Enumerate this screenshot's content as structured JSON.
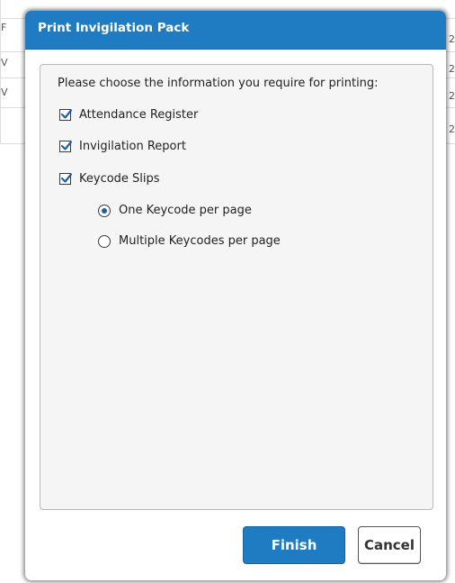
{
  "dialog": {
    "title": "Print Invigilation Pack",
    "prompt": "Please choose the information you require for printing:",
    "options": [
      {
        "label": "Attendance Register",
        "checked": true
      },
      {
        "label": "Invigilation Report",
        "checked": true
      },
      {
        "label": "Keycode Slips",
        "checked": true
      }
    ],
    "keycode_mode": {
      "options": [
        {
          "label": "One Keycode per page",
          "selected": true
        },
        {
          "label": "Multiple Keycodes per page",
          "selected": false
        }
      ]
    },
    "finish_label": "Finish",
    "cancel_label": "Cancel"
  },
  "background": {
    "left_edge": [
      "F",
      "V",
      "V"
    ],
    "right_edge": [
      "2",
      "2",
      "2",
      "2"
    ]
  },
  "colors": {
    "accent": "#1f7bc2",
    "panel_bg": "#f5f5f5",
    "radio_dot": "#1f5fa8"
  },
  "icons": {
    "checkbox_checked": "check-icon",
    "radio_selected": "radio-dot-icon"
  }
}
